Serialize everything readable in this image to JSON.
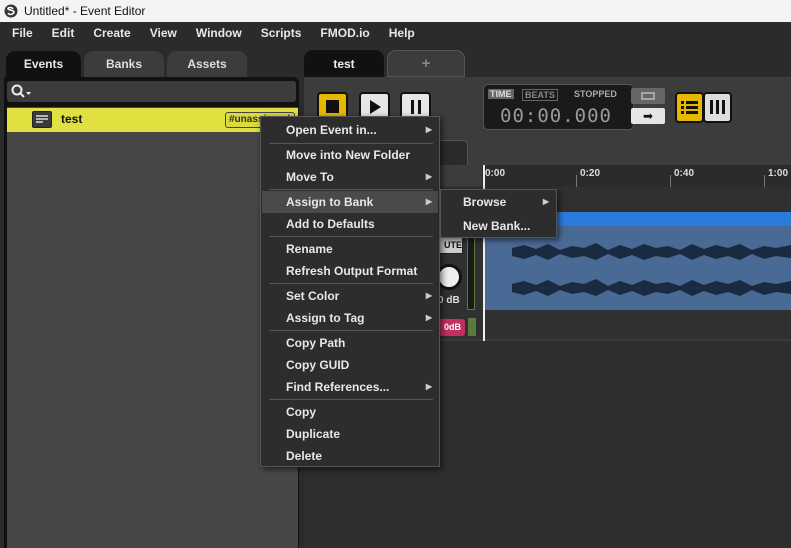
{
  "window": {
    "title": "Untitled* - Event Editor"
  },
  "menubar": [
    "File",
    "Edit",
    "Create",
    "View",
    "Window",
    "Scripts",
    "FMOD.io",
    "Help"
  ],
  "left_tabs": [
    {
      "label": "Events",
      "active": true
    },
    {
      "label": "Banks",
      "active": false
    },
    {
      "label": "Assets",
      "active": false
    }
  ],
  "event_list": {
    "items": [
      {
        "name": "test",
        "badge": "#unassigned",
        "color": "#e0e040"
      }
    ]
  },
  "editor": {
    "tabs": [
      {
        "label": "test"
      },
      {
        "label": "+"
      }
    ],
    "transport": {
      "time_label": "TIME",
      "beats_label": "BEATS",
      "status": "STOPPED",
      "time": "00:00.000"
    },
    "timeline_ticks": [
      "0:00",
      "0:20",
      "0:40",
      "1:00"
    ],
    "track": {
      "mute_label": "UTE",
      "volume": "0 dB",
      "send_label": "0dB"
    }
  },
  "context_menu": {
    "items": [
      {
        "label": "Open Event in...",
        "submenu": true
      },
      {
        "label": "Move into New Folder",
        "submenu": false
      },
      {
        "label": "Move To",
        "submenu": true
      },
      {
        "label": "Assign to Bank",
        "submenu": true,
        "highlighted": true
      },
      {
        "label": "Add to Defaults",
        "submenu": false
      },
      {
        "label": "Rename",
        "submenu": false
      },
      {
        "label": "Refresh Output Format",
        "submenu": false
      },
      {
        "label": "Set Color",
        "submenu": true
      },
      {
        "label": "Assign to Tag",
        "submenu": true
      },
      {
        "label": "Copy Path",
        "submenu": false
      },
      {
        "label": "Copy GUID",
        "submenu": false
      },
      {
        "label": "Find References...",
        "submenu": true
      },
      {
        "label": "Copy",
        "submenu": false
      },
      {
        "label": "Duplicate",
        "submenu": false
      },
      {
        "label": "Delete",
        "submenu": false
      }
    ],
    "submenu": [
      {
        "label": "Browse",
        "submenu": true
      },
      {
        "label": "New Bank...",
        "submenu": false
      }
    ]
  },
  "colors": {
    "accent_yellow": "#e6b800",
    "event_highlight": "#e0e040",
    "waveform_bar": "#2b7bdc",
    "menu_bg": "#2d2d2d"
  }
}
